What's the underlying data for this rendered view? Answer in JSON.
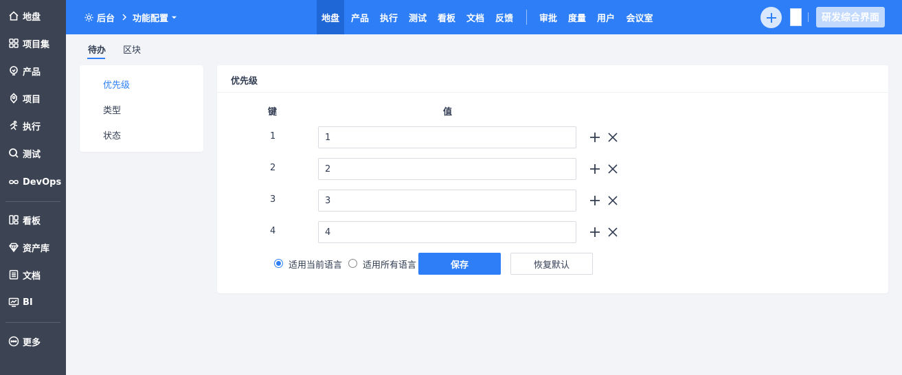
{
  "sidebar": {
    "items": [
      {
        "label": "地盘",
        "icon": "home-icon"
      },
      {
        "label": "项目集",
        "icon": "grid-icon"
      },
      {
        "label": "产品",
        "icon": "lightbulb-icon"
      },
      {
        "label": "项目",
        "icon": "project-icon"
      },
      {
        "label": "执行",
        "icon": "run-icon"
      },
      {
        "label": "测试",
        "icon": "search-icon"
      },
      {
        "label": "DevOps",
        "icon": "infinity-icon"
      },
      {
        "label": "看板",
        "icon": "kanban-icon"
      },
      {
        "label": "资产库",
        "icon": "diamond-icon"
      },
      {
        "label": "文档",
        "icon": "document-icon"
      },
      {
        "label": "BI",
        "icon": "monitor-icon"
      },
      {
        "label": "更多",
        "icon": "more-icon"
      }
    ]
  },
  "header": {
    "breadcrumb_root": "后台",
    "breadcrumb_current": "功能配置",
    "nav": [
      "地盘",
      "产品",
      "执行",
      "测试",
      "看板",
      "文档",
      "反馈",
      "审批",
      "度量",
      "用户",
      "会议室"
    ],
    "active_nav": "地盘",
    "switch_button": "研发综合界面",
    "accent_color": "#2e7ff7"
  },
  "subtabs": [
    "待办",
    "区块"
  ],
  "left_menu": [
    "优先级",
    "类型",
    "状态"
  ],
  "panel": {
    "title": "优先级",
    "key_header": "键",
    "value_header": "值",
    "rows": [
      {
        "key": "1",
        "value": "1"
      },
      {
        "key": "2",
        "value": "2"
      },
      {
        "key": "3",
        "value": "3"
      },
      {
        "key": "4",
        "value": "4"
      }
    ],
    "radio_current": "适用当前语言",
    "radio_all": "适用所有语言",
    "save_label": "保存",
    "reset_label": "恢复默认"
  }
}
